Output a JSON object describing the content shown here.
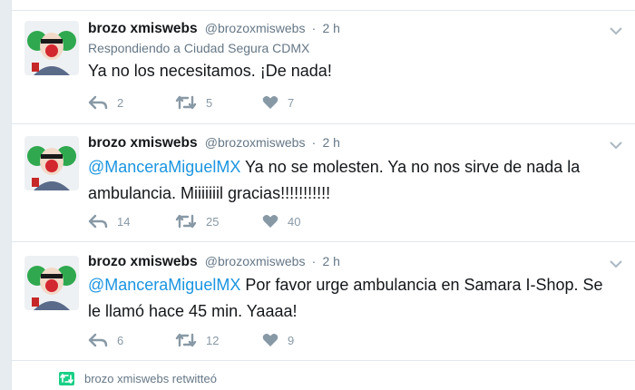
{
  "tweets": [
    {
      "fullname": "brozo xmiswebs",
      "username": "@brozoxmiswebs",
      "dot": "·",
      "time": "2 h",
      "replying": "Respondiendo a Ciudad Segura CDMX",
      "mention": "",
      "text": "Ya no los necesitamos. ¡De nada!",
      "replies": "2",
      "retweets": "5",
      "likes": "7"
    },
    {
      "fullname": "brozo xmiswebs",
      "username": "@brozoxmiswebs",
      "dot": "·",
      "time": "2 h",
      "replying": "",
      "mention": "@ManceraMiguelMX",
      "text": " Ya no se molesten. Ya no nos sirve de nada la ambulancia. Miiiiiiil gracias!!!!!!!!!!!",
      "replies": "14",
      "retweets": "25",
      "likes": "40"
    },
    {
      "fullname": "brozo xmiswebs",
      "username": "@brozoxmiswebs",
      "dot": "·",
      "time": "2 h",
      "replying": "",
      "mention": "@ManceraMiguelMX",
      "text": " Por favor urge ambulancia en Samara I-Shop. Se le llamó hace 45 min. Yaaaa!",
      "replies": "6",
      "retweets": "12",
      "likes": "9"
    }
  ],
  "retweeted_by": "brozo xmiswebs retwitteó",
  "colors": {
    "link": "#1b95e0",
    "muted": "#657786",
    "icon": "#8899a6",
    "retweet": "#19cf86"
  },
  "icons": [
    "reply-icon",
    "retweet-icon",
    "like-icon",
    "chevron-down-icon",
    "avatar-clown"
  ]
}
